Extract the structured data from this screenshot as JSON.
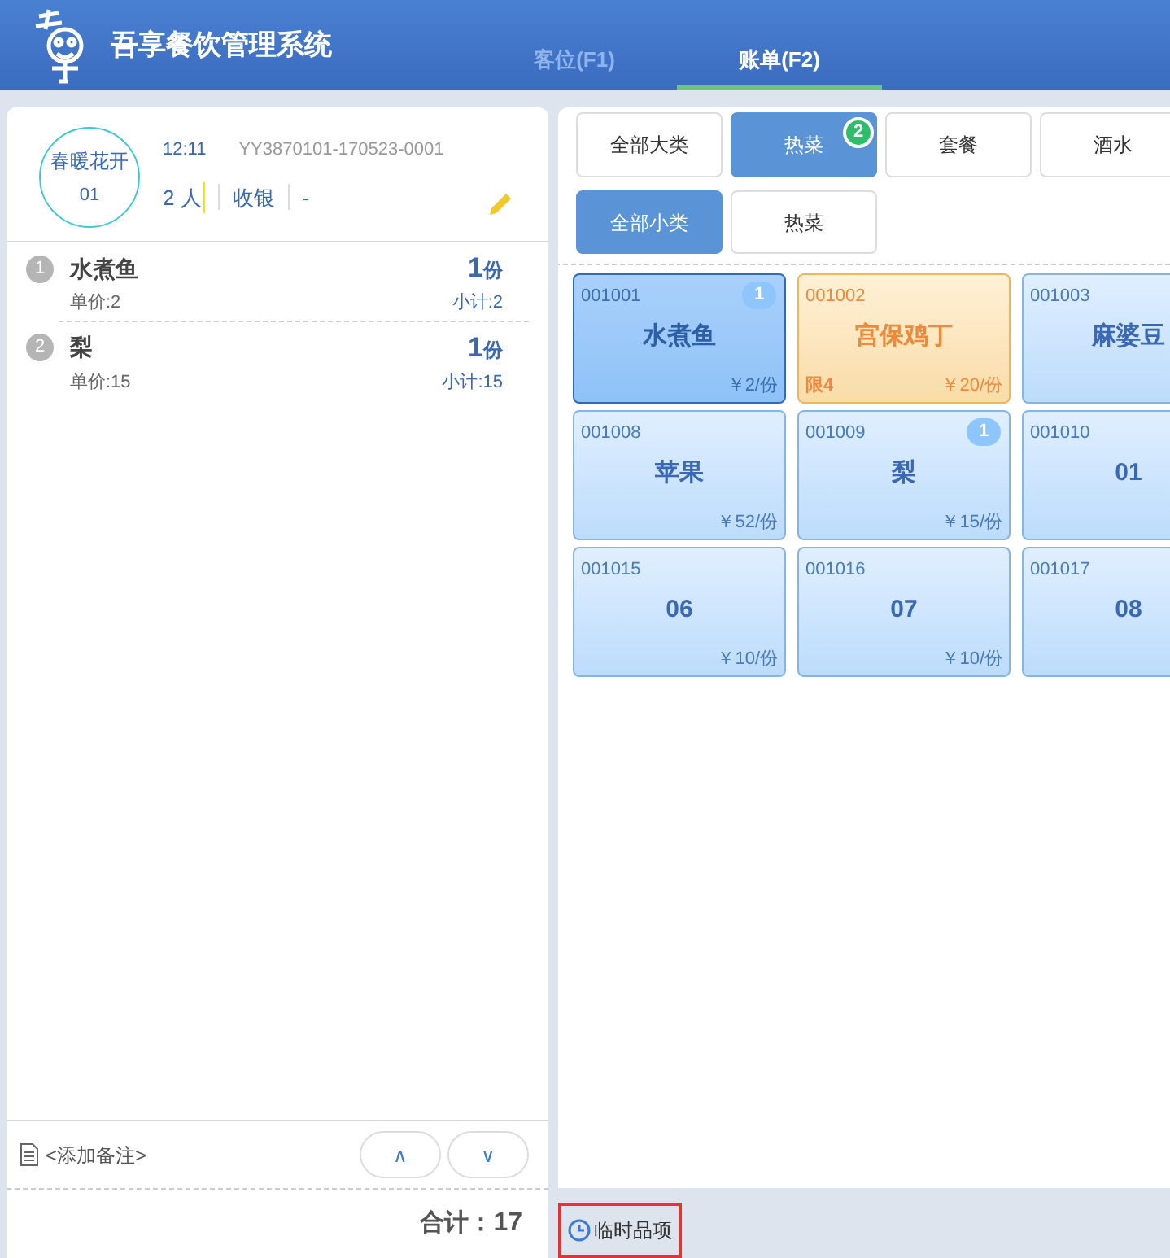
{
  "header": {
    "title": "吾享餐饮管理系统",
    "tabs": [
      {
        "label": "客位(F1)",
        "selected": false
      },
      {
        "label": "账单(F2)",
        "selected": true
      }
    ]
  },
  "order": {
    "table_name": "春暖花开",
    "table_no": "01",
    "time": "12:11",
    "bill_no": "YY3870101-170523-0001",
    "guests": "2 人",
    "cashier": "收银",
    "extra": "-",
    "items": [
      {
        "index": "1",
        "name": "水煮鱼",
        "qty": "1",
        "unit": "份",
        "unit_price": "单价:2",
        "subtotal": "小计:2"
      },
      {
        "index": "2",
        "name": "梨",
        "qty": "1",
        "unit": "份",
        "unit_price": "单价:15",
        "subtotal": "小计:15"
      }
    ],
    "note": "<添加备注>",
    "up": "∧",
    "down": "∨",
    "total_label": "合计：",
    "total": "17"
  },
  "categories": [
    {
      "label": "全部大类",
      "selected": false
    },
    {
      "label": "热菜",
      "selected": true,
      "badge": "2"
    },
    {
      "label": "套餐",
      "selected": false
    },
    {
      "label": "酒水",
      "selected": false
    }
  ],
  "subcategories": [
    {
      "label": "全部小类",
      "selected": true
    },
    {
      "label": "热菜",
      "selected": false
    }
  ],
  "dishes": [
    {
      "code": "001001",
      "name": "水煮鱼",
      "price": "￥2/份",
      "kind": "selected",
      "badge": "1"
    },
    {
      "code": "001002",
      "name": "宫保鸡丁",
      "price": "￥20/份",
      "kind": "limited",
      "limit": "限4"
    },
    {
      "code": "001003",
      "name": "麻婆豆",
      "kind": "normal"
    },
    {
      "code": "001008",
      "name": "苹果",
      "price": "￥52/份",
      "kind": "normal"
    },
    {
      "code": "001009",
      "name": "梨",
      "price": "￥15/份",
      "kind": "normal",
      "badge": "1"
    },
    {
      "code": "001010",
      "name": "01",
      "kind": "normal"
    },
    {
      "code": "001015",
      "name": "06",
      "price": "￥10/份",
      "kind": "normal"
    },
    {
      "code": "001016",
      "name": "07",
      "price": "￥10/份",
      "kind": "normal"
    },
    {
      "code": "001017",
      "name": "08",
      "kind": "normal"
    }
  ],
  "temp_item": "临时品项"
}
